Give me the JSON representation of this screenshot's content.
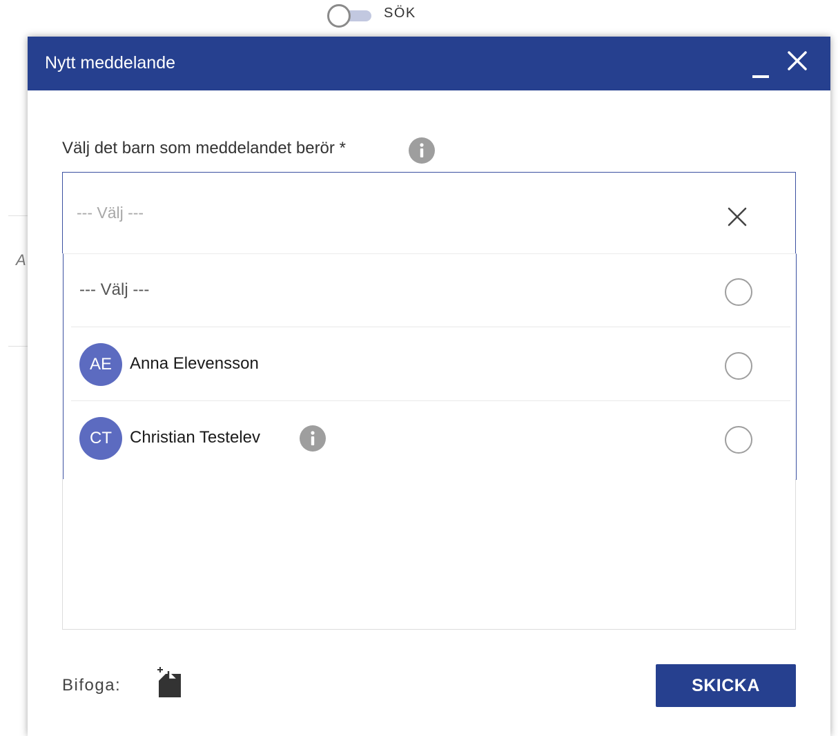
{
  "background": {
    "search_label": "SÖK",
    "partial_letter": "A"
  },
  "dialog": {
    "title": "Nytt meddelande",
    "header_color": "#26408f",
    "minimize_icon": "minimize-icon",
    "close_icon": "close-icon"
  },
  "form": {
    "child_label": "Välj det barn som meddelandet berör *",
    "select_placeholder": "--- Välj ---",
    "options": [
      {
        "label": "--- Välj ---",
        "initials": "",
        "selected": false
      },
      {
        "label": "Anna Elevensson",
        "initials": "AE",
        "selected": false
      },
      {
        "label": "Christian Testelev",
        "initials": "CT",
        "selected": false,
        "has_info": true
      }
    ],
    "avatar_color": "#5c6bc0",
    "attach_label": "Bifoga:",
    "attach_icon": "add-file-icon",
    "send_label": "SKICKA"
  }
}
